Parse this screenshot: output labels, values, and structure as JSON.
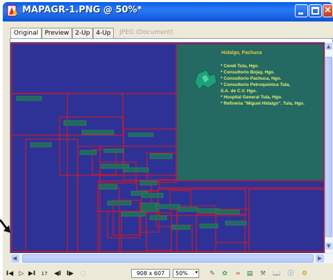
{
  "window": {
    "title": "MAPAGR-1.PNG @ 50%*",
    "icon": "fireworks-document-icon",
    "controls": {
      "minimize": "minimize-icon",
      "maximize": "maximize-icon",
      "close": "close-icon"
    }
  },
  "tabs": [
    {
      "label": "Original",
      "active": true
    },
    {
      "label": "Preview",
      "active": false
    },
    {
      "label": "2-Up",
      "active": false
    },
    {
      "label": "4-Up",
      "active": false
    },
    {
      "label": "JPEG (Document)",
      "active": false
    }
  ],
  "canvas": {
    "background_color": "#2e3296",
    "grid_line_color": "#b51f3a",
    "tab_strip_color": "#1e6b5a",
    "highlight_fill": "#246a62",
    "region_title": "Hidalgo, Pachuca",
    "locations": [
      "* Cendi Tula, Hgo.",
      "* Consultorio Bojay, Hgo.",
      "* Consultorio Pachuca, Hgo.",
      "* Consultorio Petroquimica Tula,",
      "S.A. de C.V. Hgo.",
      "* Hospital General Tula, Hgo.",
      "* Refineria \"Miguel Hidalgo\". Tula, Hgo."
    ],
    "map_icon": "hidalgo-state-map-icon"
  },
  "status": {
    "frame_number": "17",
    "dimensions": "908 x 607",
    "zoom": "50%",
    "buttons": [
      "first-frame-icon",
      "play-icon",
      "last-frame-icon",
      "prev-frame-icon",
      "next-frame-icon",
      "loop-icon"
    ],
    "tools": [
      "pencil-icon",
      "brush-icon",
      "link-icon",
      "layers-icon",
      "wrench-icon",
      "book-icon",
      "info-icon",
      "settings-icon"
    ]
  }
}
